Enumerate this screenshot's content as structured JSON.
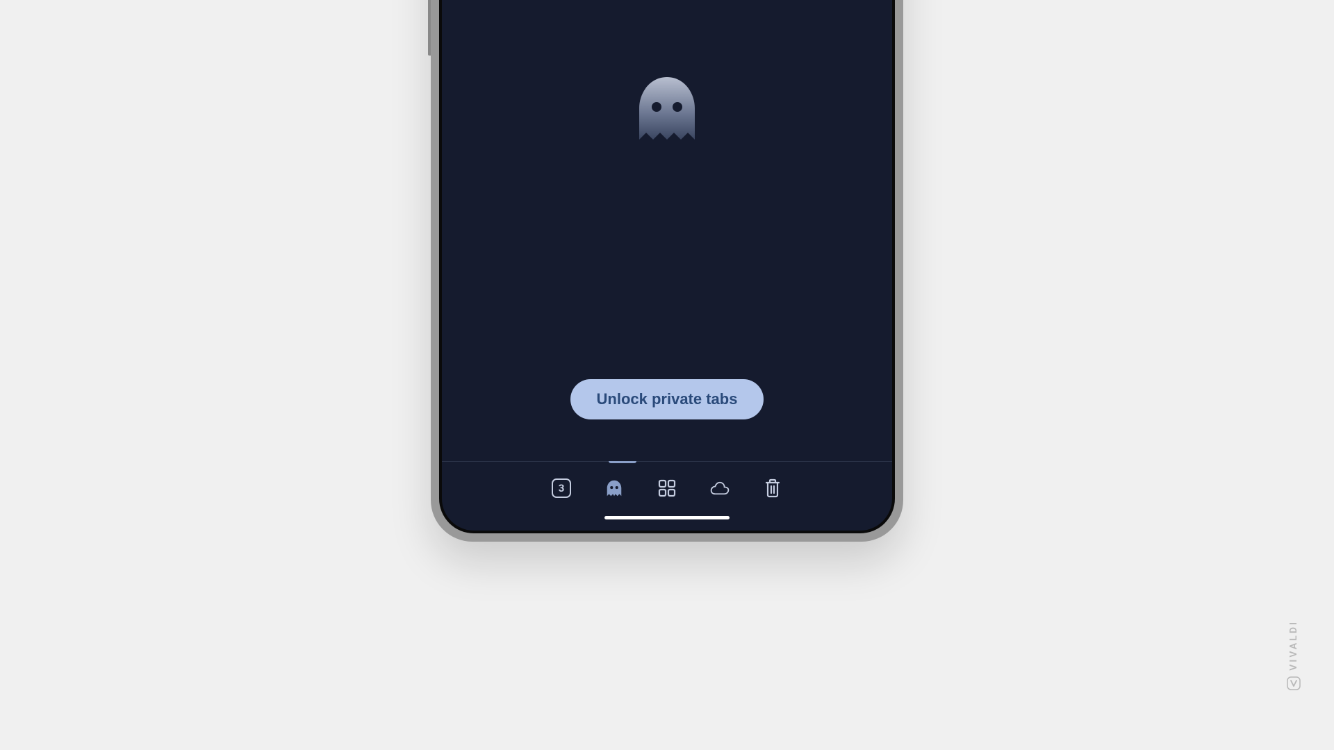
{
  "main": {
    "unlock_label": "Unlock private tabs",
    "ghost_icon": "ghost-icon"
  },
  "tabs": {
    "count": "3",
    "items": [
      {
        "name": "tabs-count",
        "active": false
      },
      {
        "name": "private-tabs",
        "active": true
      },
      {
        "name": "tab-groups",
        "active": false
      },
      {
        "name": "cloud-sync",
        "active": false
      },
      {
        "name": "delete-all",
        "active": false
      }
    ]
  },
  "brand": {
    "name": "VIVALDI"
  }
}
